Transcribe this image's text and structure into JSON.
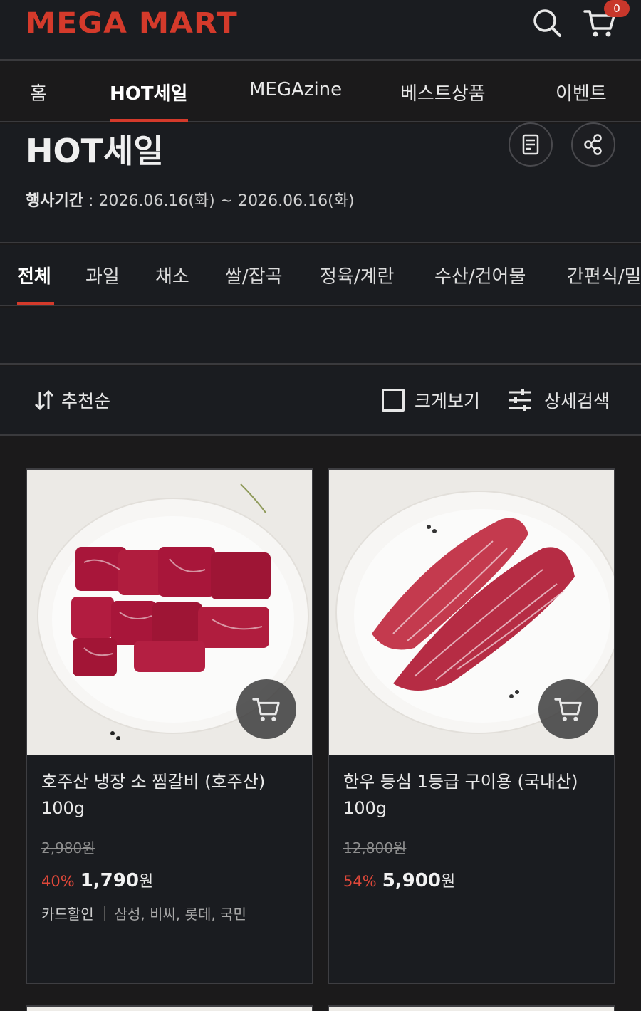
{
  "header": {
    "logo": "MEGA MART",
    "cart_count": "0"
  },
  "nav": {
    "items": [
      {
        "label": "홈"
      },
      {
        "label": "HOT세일",
        "active": true
      },
      {
        "label": "MEGAzine"
      },
      {
        "label": "베스트상품"
      },
      {
        "label": "이벤트"
      }
    ]
  },
  "page": {
    "title": "HOT세일",
    "period_label": "행사기간",
    "period_value": " : 2026.06.16(화) ~ 2026.06.16(화)"
  },
  "categories": {
    "items": [
      {
        "label": "전체",
        "active": true
      },
      {
        "label": "과일"
      },
      {
        "label": "채소"
      },
      {
        "label": "쌀/잡곡"
      },
      {
        "label": "정육/계란"
      },
      {
        "label": "수산/건어물"
      },
      {
        "label": "간편식/밀"
      }
    ]
  },
  "toolbar": {
    "sort_label": "추천순",
    "big_view_label": "크게보기",
    "detail_search_label": "상세검색"
  },
  "products": [
    {
      "name": "호주산 냉장 소 찜갈비 (호주산) 100g",
      "original_price": "2,980원",
      "discount_rate": "40%",
      "price": "1,790",
      "currency": "원",
      "card_discount_label": "카드할인",
      "card_discount_banks": "삼성, 비씨, 롯데, 국민"
    },
    {
      "name": "한우 등심 1등급 구이용 (국내산) 100g",
      "original_price": "12,800원",
      "discount_rate": "54%",
      "price": "5,900",
      "currency": "원"
    }
  ],
  "colors": {
    "brand": "#d43a2b",
    "discount": "#e0483a",
    "background": "#1a1c20"
  }
}
